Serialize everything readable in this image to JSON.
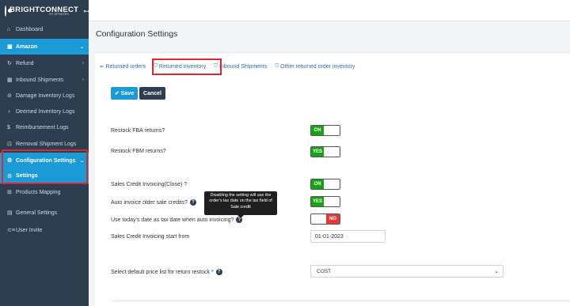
{
  "brand": {
    "name": "BRIGHTCONNECT",
    "sub": "BY APIWORX",
    "key_icon": "⊶"
  },
  "sidebar": {
    "items": [
      {
        "label": "Dashboard",
        "icon": "home-icon",
        "glyph": "⌂",
        "chevron": ""
      },
      {
        "label": "Amazon",
        "icon": "amazon-icon",
        "glyph": "▣",
        "chevron": "⌄"
      },
      {
        "label": "Refund",
        "icon": "refund-icon",
        "glyph": "↻",
        "chevron": "›"
      },
      {
        "label": "Inbound Shipments",
        "icon": "shipments-icon",
        "glyph": "▦",
        "chevron": "›"
      },
      {
        "label": "Damage Inventory Logs",
        "icon": "damage-icon",
        "glyph": "⊘",
        "chevron": ""
      },
      {
        "label": "Deemed Inventory Logs",
        "icon": "deemed-icon",
        "glyph": "♀",
        "chevron": ""
      },
      {
        "label": "Reimbursement Logs",
        "icon": "dollar-icon",
        "glyph": "$",
        "chevron": ""
      },
      {
        "label": "Removal Shipment Logs",
        "icon": "removal-icon",
        "glyph": "⊡",
        "chevron": ""
      },
      {
        "label": "Configuration Settings",
        "icon": "config-icon",
        "glyph": "⚙",
        "chevron": "⌄"
      },
      {
        "label": "Settings",
        "icon": "gear-icon",
        "glyph": "⚙",
        "chevron": ""
      },
      {
        "label": "Products Mapping",
        "icon": "mapping-icon",
        "glyph": "⊞",
        "chevron": ""
      },
      {
        "label": "General Settings",
        "icon": "general-icon",
        "glyph": "▤",
        "chevron": ""
      },
      {
        "label": "User Invite",
        "icon": "user-invite-icon",
        "glyph": "⊂≡",
        "chevron": ""
      }
    ]
  },
  "page": {
    "title": "Configuration Settings"
  },
  "tabs": [
    {
      "label": "Returned orders",
      "glyph": "⇐"
    },
    {
      "label": "Returned inventory",
      "glyph": "⛉"
    },
    {
      "label": "Inbound Shipments",
      "glyph": "⛉"
    },
    {
      "label": "Other returned order inventory",
      "glyph": "⛉"
    }
  ],
  "actions": {
    "save_label": "Save",
    "save_glyph": "✔",
    "cancel_label": "Cancel"
  },
  "settings": {
    "restock_fba": {
      "label": "Restock FBA returns?",
      "toggle": "ON"
    },
    "restock_fbm": {
      "label": "Restock FBM returns?",
      "toggle": "YES"
    },
    "sales_credit": {
      "label": "Sales Credit Invoicing(Close) ?",
      "toggle": "ON"
    },
    "auto_invoice": {
      "label": "Auto invoice older sale credits?",
      "toggle": "YES"
    },
    "use_today": {
      "label": "Use today's date as tax date when auto invoicing?",
      "toggle": "NO"
    },
    "start_from": {
      "label": "Sales Credit Invoicing start from",
      "value": "01-01-2023"
    },
    "price_list": {
      "label": "Select default price list for return restock *",
      "value": "COST"
    }
  },
  "tooltip": {
    "text": "Disabling the setting will use the order's tax date on the tax field of Sale credit"
  },
  "help_glyph": "?",
  "select_chevron": "⌄",
  "colors": {
    "sidebar": "#2c3e50",
    "accent": "#1a9ad6",
    "on": "#16a312",
    "off": "#e53935",
    "highlight": "#e0262c"
  }
}
